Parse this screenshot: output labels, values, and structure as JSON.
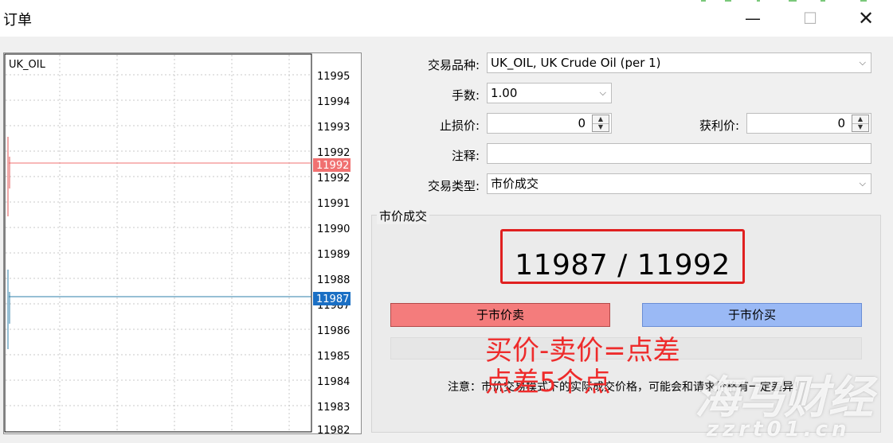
{
  "window": {
    "title": "订单",
    "minimize_glyph": "—",
    "maximize_glyph": "☐",
    "close_glyph": "✕"
  },
  "chart": {
    "symbol": "UK_OIL",
    "price_labels": [
      "11995",
      "11994",
      "11993",
      "11992",
      "11992",
      "11991",
      "11990",
      "11989",
      "11988",
      "11987",
      "11986",
      "11985",
      "11984",
      "11983",
      "11982"
    ],
    "ask_tag": "11992",
    "bid_tag": "11987",
    "ask_color": "#f07070",
    "bid_color": "#1a6fc4"
  },
  "form": {
    "symbol_label": "交易品种:",
    "symbol_value": "UK_OIL, UK Crude Oil (per 1)",
    "volume_label": "手数:",
    "volume_value": "1.00",
    "stoploss_label": "止损价:",
    "stoploss_value": "0",
    "takeprofit_label": "获利价:",
    "takeprofit_value": "0",
    "comment_label": "注释:",
    "comment_value": "",
    "type_label": "交易类型:",
    "type_value": "市价成交"
  },
  "market": {
    "group_title": "市价成交",
    "quote": "11987 / 11992",
    "sell_button": "于市价卖",
    "buy_button": "于市价买",
    "note": "注意：市价交易模式下的实际成交价格，可能会和请求价格有一定差异！"
  },
  "annotations": {
    "line1": "买价-卖价=点差",
    "line2": "点差5个点",
    "color": "#ee2b2b"
  },
  "watermark": {
    "brand": "海马财经",
    "url": "zzrt01.cn"
  },
  "icons": {
    "dropdown": "chevron-down-icon",
    "spin_up": "triangle-up-icon",
    "spin_down": "triangle-down-icon"
  }
}
